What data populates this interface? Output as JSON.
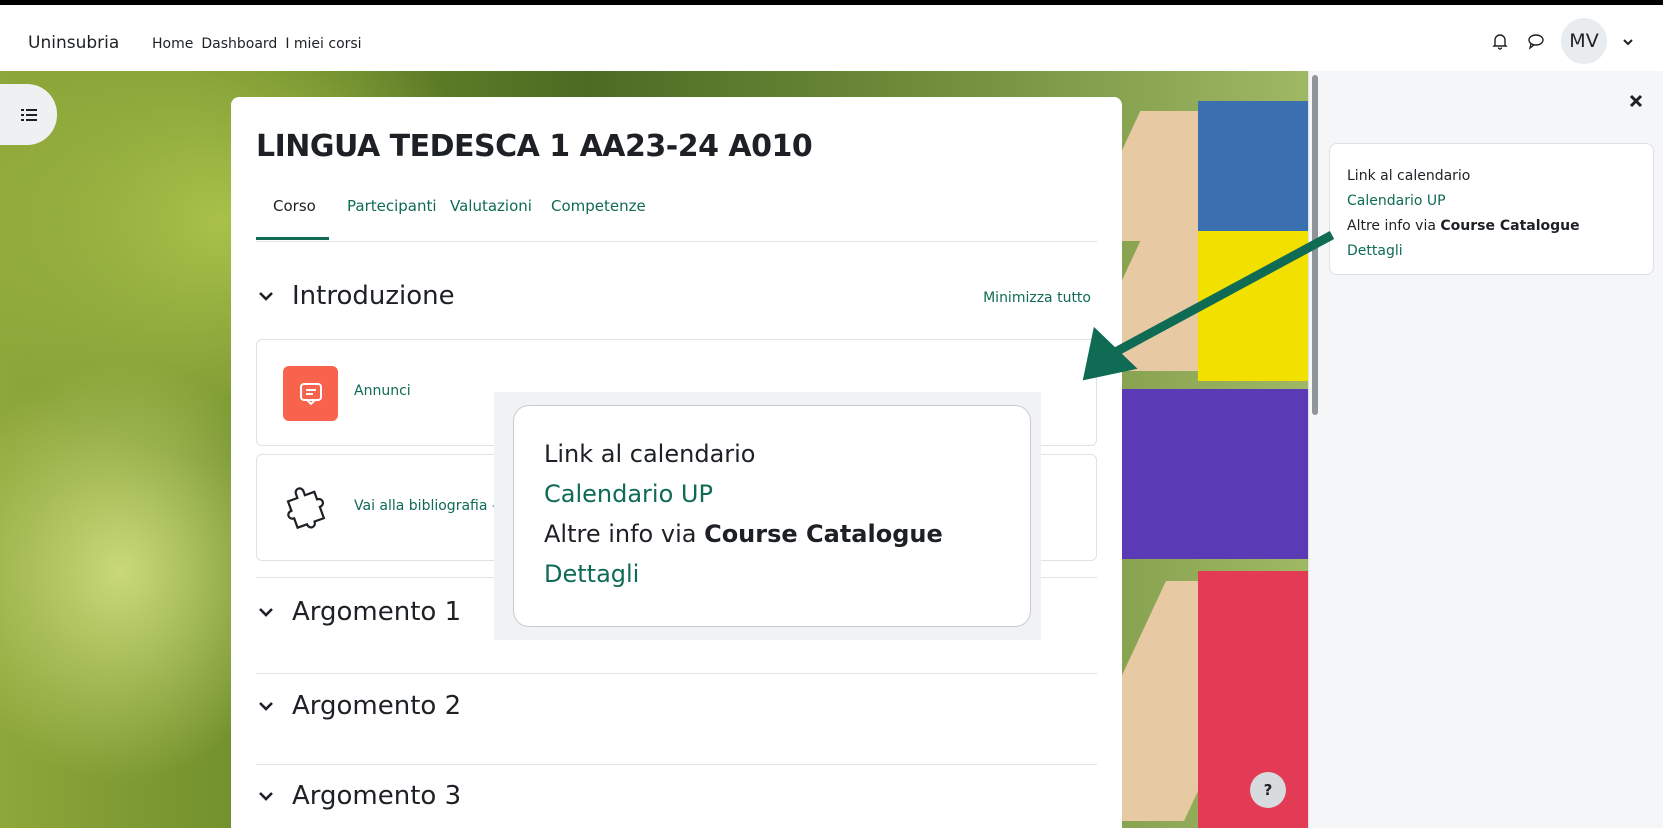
{
  "navbar": {
    "brand": "Uninsubria",
    "links": [
      "Home",
      "Dashboard",
      "I miei corsi"
    ],
    "user_initials": "MV"
  },
  "course": {
    "title": "LINGUA TEDESCA 1 AA23-24 A010",
    "tabs": [
      "Corso",
      "Partecipanti",
      "Valutazioni",
      "Competenze"
    ],
    "minimize_all": "Minimizza tutto",
    "sections": [
      "Introduzione",
      "Argomento 1",
      "Argomento 2",
      "Argomento 3"
    ],
    "activities": [
      {
        "label": "Annunci",
        "icon": "forum-icon",
        "color": "#f7634d"
      },
      {
        "label": "Vai alla bibliografia – F",
        "icon": "puzzle-icon"
      }
    ]
  },
  "block": {
    "line1": "Link al calendario",
    "link1": "Calendario UP",
    "line3_prefix": "Altre info via ",
    "line3_bold": "Course Catalogue",
    "link2": "Dettagli"
  },
  "help": "?",
  "colors": {
    "accent": "#0f6b54",
    "announcement": "#f7634d",
    "arrow": "#0f6b54"
  }
}
